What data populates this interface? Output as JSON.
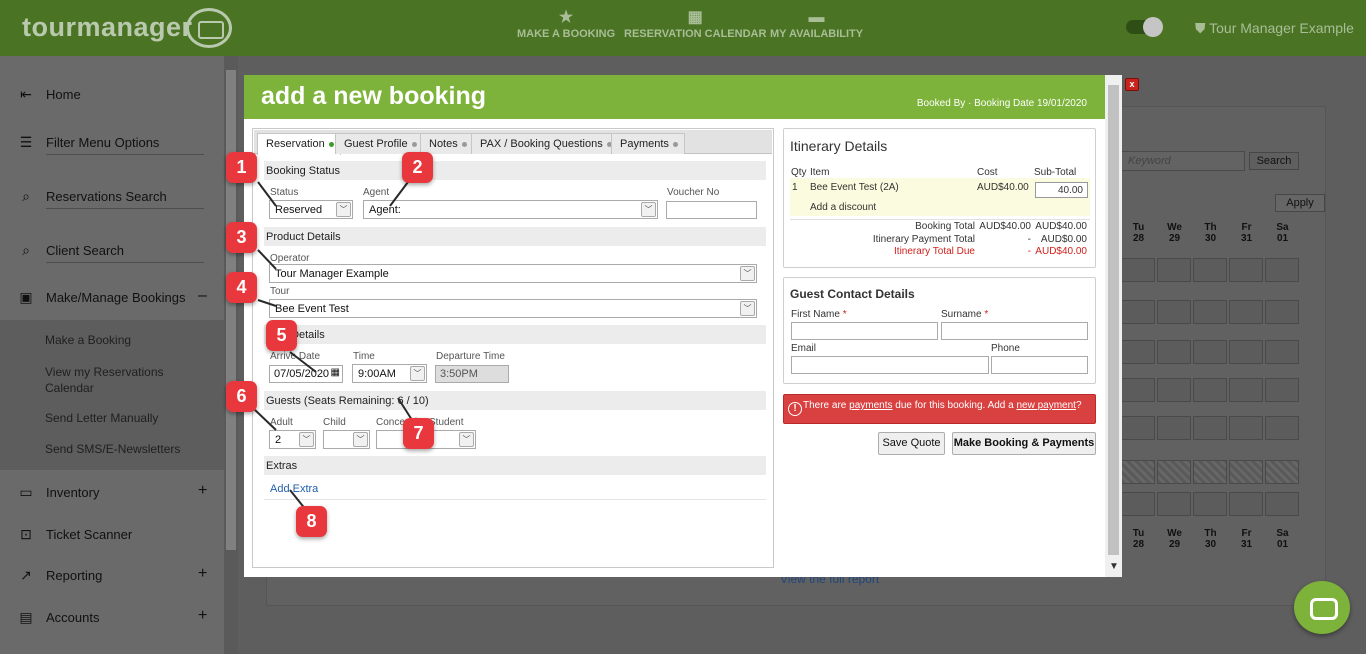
{
  "app": {
    "logo": "tourmanager",
    "nav": [
      {
        "label": "MAKE A BOOKING",
        "icon": "star-icon"
      },
      {
        "label": "RESERVATION CALENDAR",
        "icon": "calendar-icon"
      },
      {
        "label": "MY AVAILABILITY",
        "icon": "bed-icon"
      }
    ],
    "user": "Tour Manager Example"
  },
  "sidebar": {
    "items": [
      {
        "label": "Home",
        "icon": "arrow-left-icon"
      },
      {
        "label": "Filter Menu Options",
        "icon": "filter-icon"
      },
      {
        "label": "Reservations Search",
        "icon": "search-icon"
      },
      {
        "label": "Client Search",
        "icon": "search-icon"
      },
      {
        "label": "Make/Manage Bookings",
        "icon": "calendar-check-icon",
        "toggle": "–"
      },
      {
        "label": "Inventory",
        "icon": "bus-icon",
        "toggle": "+"
      },
      {
        "label": "Ticket Scanner",
        "icon": "scan-icon"
      },
      {
        "label": "Reporting",
        "icon": "chart-icon",
        "toggle": "+"
      },
      {
        "label": "Accounts",
        "icon": "card-icon",
        "toggle": "+"
      }
    ],
    "sub_items": [
      "Make a Booking",
      "View my Reservations Calendar",
      "Send Letter Manually",
      "Send SMS/E-Newsletters"
    ]
  },
  "background": {
    "search_placeholder": "Keyword",
    "search_button": "Search",
    "apply_button": "Apply",
    "days": [
      {
        "d": "Tu",
        "n": "28"
      },
      {
        "d": "We",
        "n": "29"
      },
      {
        "d": "Th",
        "n": "30"
      },
      {
        "d": "Fr",
        "n": "31"
      },
      {
        "d": "Sa",
        "n": "01"
      }
    ],
    "view_report_link": "View the full report"
  },
  "modal": {
    "title": "add a new booking",
    "subtitle": "Booked By · Booking Date 19/01/2020",
    "close": "x",
    "tabs": [
      "Reservation",
      "Guest Profile",
      "Notes",
      "PAX / Booking Questions",
      "Payments"
    ],
    "sections": {
      "booking_status": "Booking Status",
      "product_details": "Product Details",
      "stay_details": "Stay Details",
      "guests": "Guests (Seats Remaining: 6 / 10)",
      "extras": "Extras"
    },
    "fields": {
      "status": {
        "label": "Status",
        "value": "Reserved"
      },
      "agent": {
        "label": "Agent",
        "value": "Agent:"
      },
      "voucher": {
        "label": "Voucher No",
        "value": ""
      },
      "operator": {
        "label": "Operator",
        "value": "Tour Manager Example"
      },
      "tour": {
        "label": "Tour",
        "value": "Bee Event Test"
      },
      "arrive_date": {
        "label": "Arrive Date",
        "value": "07/05/2020"
      },
      "time": {
        "label": "Time",
        "value": "9:00AM"
      },
      "departure_time": {
        "label": "Departure Time",
        "value": "3:50PM"
      },
      "adult": {
        "label": "Adult",
        "value": "2"
      },
      "child": {
        "label": "Child",
        "value": ""
      },
      "concession": {
        "label": "Concession",
        "value": ""
      },
      "student": {
        "label": "Student",
        "value": ""
      }
    },
    "add_extra": "Add Extra",
    "itinerary": {
      "title": "Itinerary Details",
      "headers": {
        "qty": "Qty",
        "item": "Item",
        "cost": "Cost",
        "subtotal": "Sub-Total"
      },
      "row": {
        "qty": "1",
        "item": "Bee Event Test (2A)",
        "cost": "AUD$40.00",
        "subtotal": "40.00"
      },
      "add_discount": "Add a discount",
      "totals": [
        {
          "label": "Booking Total",
          "a": "AUD$40.00",
          "b": "AUD$40.00"
        },
        {
          "label": "Itinerary Payment Total",
          "a": "-",
          "b": "AUD$0.00"
        },
        {
          "label": "Itinerary Total Due",
          "a": "-",
          "b": "AUD$40.00"
        }
      ]
    },
    "guest_contact": {
      "title": "Guest Contact Details",
      "first_name": "First Name",
      "surname": "Surname",
      "email": "Email",
      "phone": "Phone",
      "required_mark": "*"
    },
    "alert": {
      "text1": "There are ",
      "link1": "payments",
      "text2": " due for this booking. Add a ",
      "link2": "new payment",
      "text3": "?"
    },
    "buttons": {
      "save_quote": "Save Quote",
      "make_booking": "Make Booking & Payments"
    }
  },
  "annotations": [
    "1",
    "2",
    "3",
    "4",
    "5",
    "6",
    "7",
    "8"
  ],
  "colors": {
    "brand_green": "#7db33a",
    "topbar_green": "#4a7424",
    "marker_red": "#e8383d",
    "alert_red": "#d94040",
    "link_blue": "#1f5fa8"
  }
}
